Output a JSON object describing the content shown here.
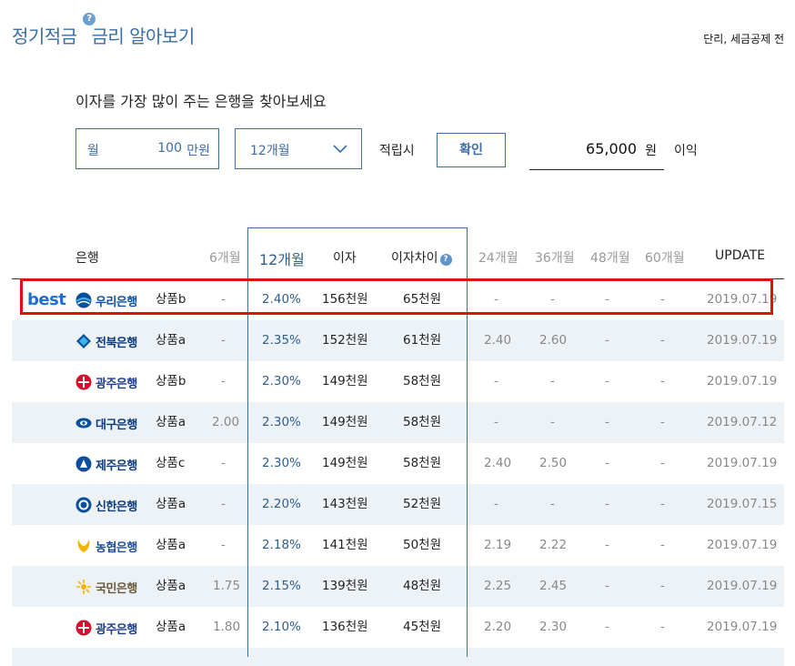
{
  "header": {
    "title_part1": "정기적금",
    "title_part2": "금리 알아보기",
    "help_glyph": "?",
    "note": "단리, 세금공제 전"
  },
  "subtitle": "이자를 가장 많이 주는 은행을 찾아보세요",
  "form": {
    "month_label": "월",
    "amount": "100",
    "amount_unit": "만원",
    "period_value": "12개월",
    "accumulate_label": "적립시",
    "confirm_label": "확인",
    "result_value": "65,000",
    "result_unit": "원",
    "profit_label": "이익"
  },
  "table": {
    "headers": {
      "bank": "은행",
      "m6": "6개월",
      "m12": "12개월",
      "interest": "이자",
      "diff": "이자차이",
      "m24": "24개월",
      "m36": "36개월",
      "m48": "48개월",
      "m60": "60개월",
      "update": "UPDATE"
    },
    "best_label": "best",
    "rows": [
      {
        "bank": "우리은행",
        "logo": "woori",
        "product": "상품b",
        "m6": "-",
        "m12": "2.40%",
        "interest": "156천원",
        "diff": "65천원",
        "m24": "-",
        "m36": "-",
        "m48": "-",
        "m60": "-",
        "update": "2019.07.19"
      },
      {
        "bank": "전북은행",
        "logo": "jeonbuk",
        "product": "상품a",
        "m6": "-",
        "m12": "2.35%",
        "interest": "152천원",
        "diff": "61천원",
        "m24": "2.40",
        "m36": "2.60",
        "m48": "-",
        "m60": "-",
        "update": "2019.07.19"
      },
      {
        "bank": "광주은행",
        "logo": "gwangju",
        "product": "상품b",
        "m6": "-",
        "m12": "2.30%",
        "interest": "149천원",
        "diff": "58천원",
        "m24": "-",
        "m36": "-",
        "m48": "-",
        "m60": "-",
        "update": "2019.07.19"
      },
      {
        "bank": "대구은행",
        "logo": "daegu",
        "product": "상품a",
        "m6": "2.00",
        "m12": "2.30%",
        "interest": "149천원",
        "diff": "58천원",
        "m24": "-",
        "m36": "-",
        "m48": "-",
        "m60": "-",
        "update": "2019.07.12"
      },
      {
        "bank": "제주은행",
        "logo": "jeju",
        "product": "상품c",
        "m6": "-",
        "m12": "2.30%",
        "interest": "149천원",
        "diff": "58천원",
        "m24": "2.40",
        "m36": "2.50",
        "m48": "-",
        "m60": "-",
        "update": "2019.07.19"
      },
      {
        "bank": "신한은행",
        "logo": "shinhan",
        "product": "상품a",
        "m6": "-",
        "m12": "2.20%",
        "interest": "143천원",
        "diff": "52천원",
        "m24": "-",
        "m36": "-",
        "m48": "-",
        "m60": "-",
        "update": "2019.07.15"
      },
      {
        "bank": "농협은행",
        "logo": "nonghyup",
        "product": "상품a",
        "m6": "-",
        "m12": "2.18%",
        "interest": "141천원",
        "diff": "50천원",
        "m24": "2.19",
        "m36": "2.22",
        "m48": "-",
        "m60": "-",
        "update": "2019.07.19"
      },
      {
        "bank": "국민은행",
        "logo": "kookmin",
        "product": "상품a",
        "m6": "1.75",
        "m12": "2.15%",
        "interest": "139천원",
        "diff": "48천원",
        "m24": "2.25",
        "m36": "2.45",
        "m48": "-",
        "m60": "-",
        "update": "2019.07.19"
      },
      {
        "bank": "광주은행",
        "logo": "gwangju",
        "product": "상품a",
        "m6": "1.80",
        "m12": "2.10%",
        "interest": "136천원",
        "diff": "45천원",
        "m24": "2.20",
        "m36": "2.30",
        "m48": "-",
        "m60": "-",
        "update": "2019.07.19"
      }
    ]
  },
  "colors": {
    "accent": "#3b6ea5",
    "selected_text": "#2c5e93",
    "best_border": "#e01010",
    "row_alt": "#edf2f7"
  }
}
